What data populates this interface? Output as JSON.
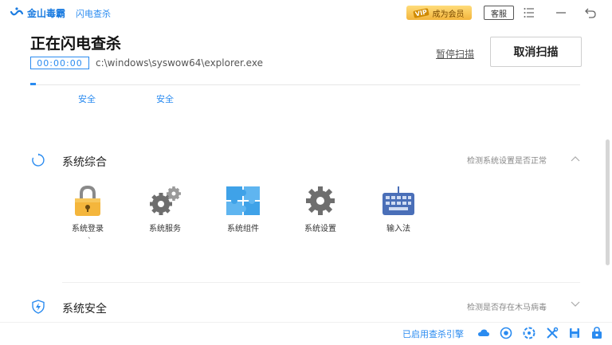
{
  "titlebar": {
    "app_name": "金山毒霸",
    "sub_name": "闪电查杀",
    "vip_tag": "VIP",
    "vip_label": "成为会员",
    "service_label": "客服",
    "icons": [
      "menu-icon",
      "minimize-icon",
      "back-icon"
    ]
  },
  "header": {
    "title": "正在闪电查杀",
    "timer": "00:00:00",
    "scan_path": "c:\\windows\\syswow64\\explorer.exe",
    "pause_label": "暂停扫描",
    "cancel_label": "取消扫描",
    "progress": 0.01
  },
  "status_row": {
    "items": [
      "安全",
      "安全"
    ]
  },
  "sections": [
    {
      "title": "系统综合",
      "description": "检测系统设置是否正常",
      "icon": "refresh-icon",
      "expanded": true,
      "items": [
        {
          "label": "系统登录",
          "icon": "lock-icon"
        },
        {
          "label": "系统服务",
          "icon": "gears-icon"
        },
        {
          "label": "系统组件",
          "icon": "puzzle-icon"
        },
        {
          "label": "系统设置",
          "icon": "gear-icon"
        },
        {
          "label": "输入法",
          "icon": "keyboard-icon"
        }
      ],
      "marker": "`"
    },
    {
      "title": "系统安全",
      "description": "检测是否存在木马病毒",
      "icon": "shield-icon",
      "expanded": false
    }
  ],
  "bottombar": {
    "engine_text": "已启用查杀引擎",
    "icons": [
      "cloud-icon",
      "engine-eye-icon",
      "engine-ring-icon",
      "tools-icon",
      "save-icon",
      "box-icon"
    ]
  },
  "colors": {
    "accent": "#2a8bf0",
    "vip_gold": "#f3b53c"
  }
}
